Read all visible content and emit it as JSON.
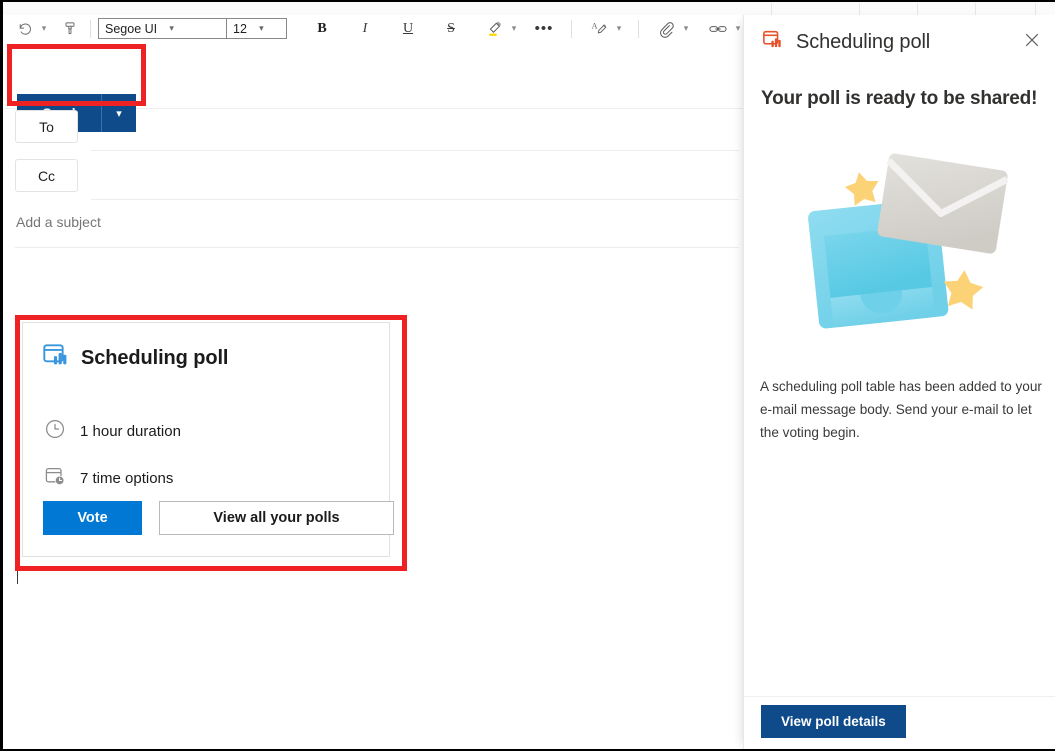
{
  "toolbar": {
    "undo_icon": "undo-icon",
    "format_painter_icon": "format-painter-icon",
    "font_family": "Segoe UI",
    "font_size": "12",
    "bold_label": "B",
    "italic_label": "I",
    "underline_label": "U",
    "strikethrough_label": "S",
    "highlight_icon": "highlight-pen-icon",
    "more_label": "•••",
    "font_color_icon": "font-color-icon",
    "attach_icon": "paperclip-icon",
    "link_icon": "link-icon",
    "signature_icon": "signature-pen-icon",
    "chevron": "⌄"
  },
  "command_bar": {
    "send_label": "Send",
    "send_caret_icon": "chevron-down-icon"
  },
  "compose": {
    "to_label": "To",
    "cc_label": "Cc",
    "subject_value": "",
    "subject_placeholder": "Add a subject"
  },
  "poll_card": {
    "icon": "scheduling-poll-icon",
    "title": "Scheduling poll",
    "duration_icon": "clock-icon",
    "duration_label": "1 hour duration",
    "options_icon": "calendar-clock-icon",
    "options_label": "7 time options",
    "vote_label": "Vote",
    "view_all_label": "View all your polls"
  },
  "task_pane": {
    "icon": "scheduling-poll-icon",
    "title": "Scheduling poll",
    "close_icon": "close-icon",
    "heading": "Your poll is ready to be shared!",
    "illustration": "envelope-and-stars-illustration",
    "description": "A scheduling poll table has been added to your e-mail message body. Send your e-mail to let the voting begin.",
    "footer_button_label": "View poll details"
  },
  "annotations": [
    {
      "name": "send-button-highlight",
      "color": "#ee2222"
    },
    {
      "name": "scheduling-poll-card-highlight",
      "color": "#ee2222"
    }
  ],
  "colors": {
    "send_blue": "#0F4A8A",
    "vote_blue": "#0078D4",
    "poll_icon_blue": "#3A96DD",
    "pane_icon_orange": "#E8502A",
    "annotation_red": "#EE2222"
  }
}
